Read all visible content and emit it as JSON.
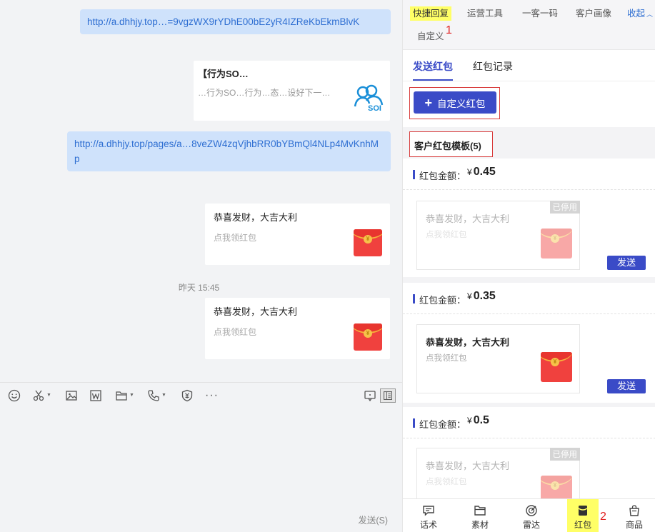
{
  "chat": {
    "messages": [
      {
        "type": "link",
        "text": "http://a.dhhjy.top…=9vgzWX9rYDhE00bE2yR4IZReKbEkmBlvK"
      },
      {
        "type": "article",
        "title": "【行为SO…",
        "desc": "…行为SO…行为…态…设好下一…",
        "logo": "SOI"
      },
      {
        "type": "link",
        "text": "http://a.dhhjy.top/pages/a…8veZW4zqVjhbRR0bYBmQl4NLp4MvKnhMp"
      },
      {
        "type": "redpacket",
        "title": "恭喜发财，大吉大利",
        "desc": "点我领红包"
      },
      {
        "type": "redpacket",
        "title": "恭喜发财，大吉大利",
        "desc": "点我领红包"
      }
    ],
    "timestamp": "昨天 15:45",
    "send_label": "发送(S)"
  },
  "panel": {
    "tabs": [
      "快捷回复",
      "运营工具",
      "一客一码",
      "客户画像"
    ],
    "collapse": "收起",
    "custom_tab": "自定义",
    "annotations": [
      "1",
      "2"
    ],
    "subtabs": [
      "发送红包",
      "红包记录"
    ],
    "custom_button": "自定义红包",
    "template_header": "客户红包模板(5)",
    "amount_label": "红包金额：",
    "currency": "¥",
    "templates": [
      {
        "amount": "0.45",
        "title": "恭喜发财，大吉大利",
        "desc": "点我领红包",
        "stopped": "已停用",
        "send": "发送"
      },
      {
        "amount": "0.35",
        "title": "恭喜发财，大吉大利",
        "desc": "点我领红包",
        "stopped": "",
        "send": "发送"
      },
      {
        "amount": "0.5",
        "title": "恭喜发财，大吉大利",
        "desc": "点我领红包",
        "stopped": "已停用",
        "send": ""
      }
    ],
    "bottom_nav": [
      {
        "label": "话术",
        "icon": "message-icon"
      },
      {
        "label": "素材",
        "icon": "folder-icon"
      },
      {
        "label": "雷达",
        "icon": "radar-icon"
      },
      {
        "label": "红包",
        "icon": "red-packet-icon"
      },
      {
        "label": "商品",
        "icon": "bag-icon"
      }
    ]
  },
  "colors": {
    "accent": "#3a4bc7",
    "highlight": "#ffff66",
    "annotation": "#e02020",
    "link": "#2f6fd2",
    "link_bg": "#cfe2fb"
  }
}
